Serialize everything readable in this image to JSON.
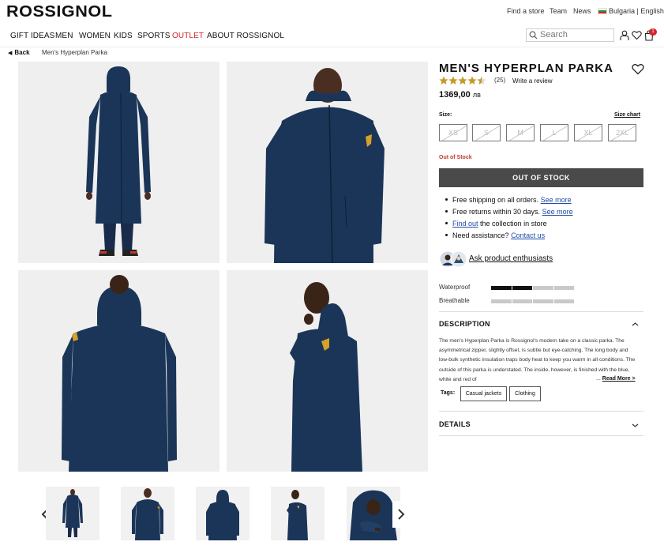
{
  "header": {
    "logo": "ROSSIGNOL",
    "links": [
      "Find a store",
      "Team",
      "News"
    ],
    "locale": "Bulgaria | English",
    "search_placeholder": "Search",
    "cart_count": "1"
  },
  "nav": {
    "items": [
      "GIFT IDEAS",
      "MEN",
      "WOMEN",
      "KIDS",
      "SPORTS",
      "OUTLET",
      "ABOUT ROSSIGNOL"
    ]
  },
  "breadcrumb": {
    "back": "Back",
    "current": "Men's Hyperplan Parka"
  },
  "product": {
    "title": "MEN'S HYPERPLAN PARKA",
    "rating": 4.5,
    "review_count": "(25)",
    "write_review": "Write a review",
    "price": "1369,00",
    "currency": "лв",
    "size_label": "Size:",
    "size_chart": "Size chart",
    "sizes": [
      "XS",
      "S",
      "M",
      "L",
      "XL",
      "2XL"
    ],
    "stock_status": "Out of Stock",
    "stock_button": "OUT OF STOCK"
  },
  "services": {
    "line1_text": "Free shipping on all orders.",
    "line1_link": "See more",
    "line2_text": "Free returns within 30 days.",
    "line2_link": "See more",
    "line3_link": "Find out",
    "line3_text": "the collection in store",
    "line4_text": "Need assistance?",
    "line4_link": "Contact us"
  },
  "ask": {
    "label": "Ask product enthusiasts"
  },
  "features": [
    {
      "label": "Waterproof",
      "level": 2,
      "max": 4
    },
    {
      "label": "Breathable",
      "level": 0,
      "max": 4
    }
  ],
  "description": {
    "heading": "DESCRIPTION",
    "text": "The men's Hyperplan Parka is Rossignol's modern take on a classic parka. The asymmetrical zipper, slightly offset, is subtle but eye-catching. The long body and low-bulk synthetic insulation traps body heat to keep you warm in all conditions. The outside of this parka is understated. The inside, however, is finished with the blue, white and red of",
    "read_more": "Read More >",
    "tags_label": "Tags:",
    "tags": [
      "Casual jackets",
      "Clothing"
    ]
  },
  "details": {
    "heading": "DETAILS"
  },
  "colors": {
    "jacket_navy": "#1b3558",
    "outlet_red": "#d0262c",
    "rating_gold": "#c49a2a",
    "button_dark": "#4a4a4a"
  }
}
